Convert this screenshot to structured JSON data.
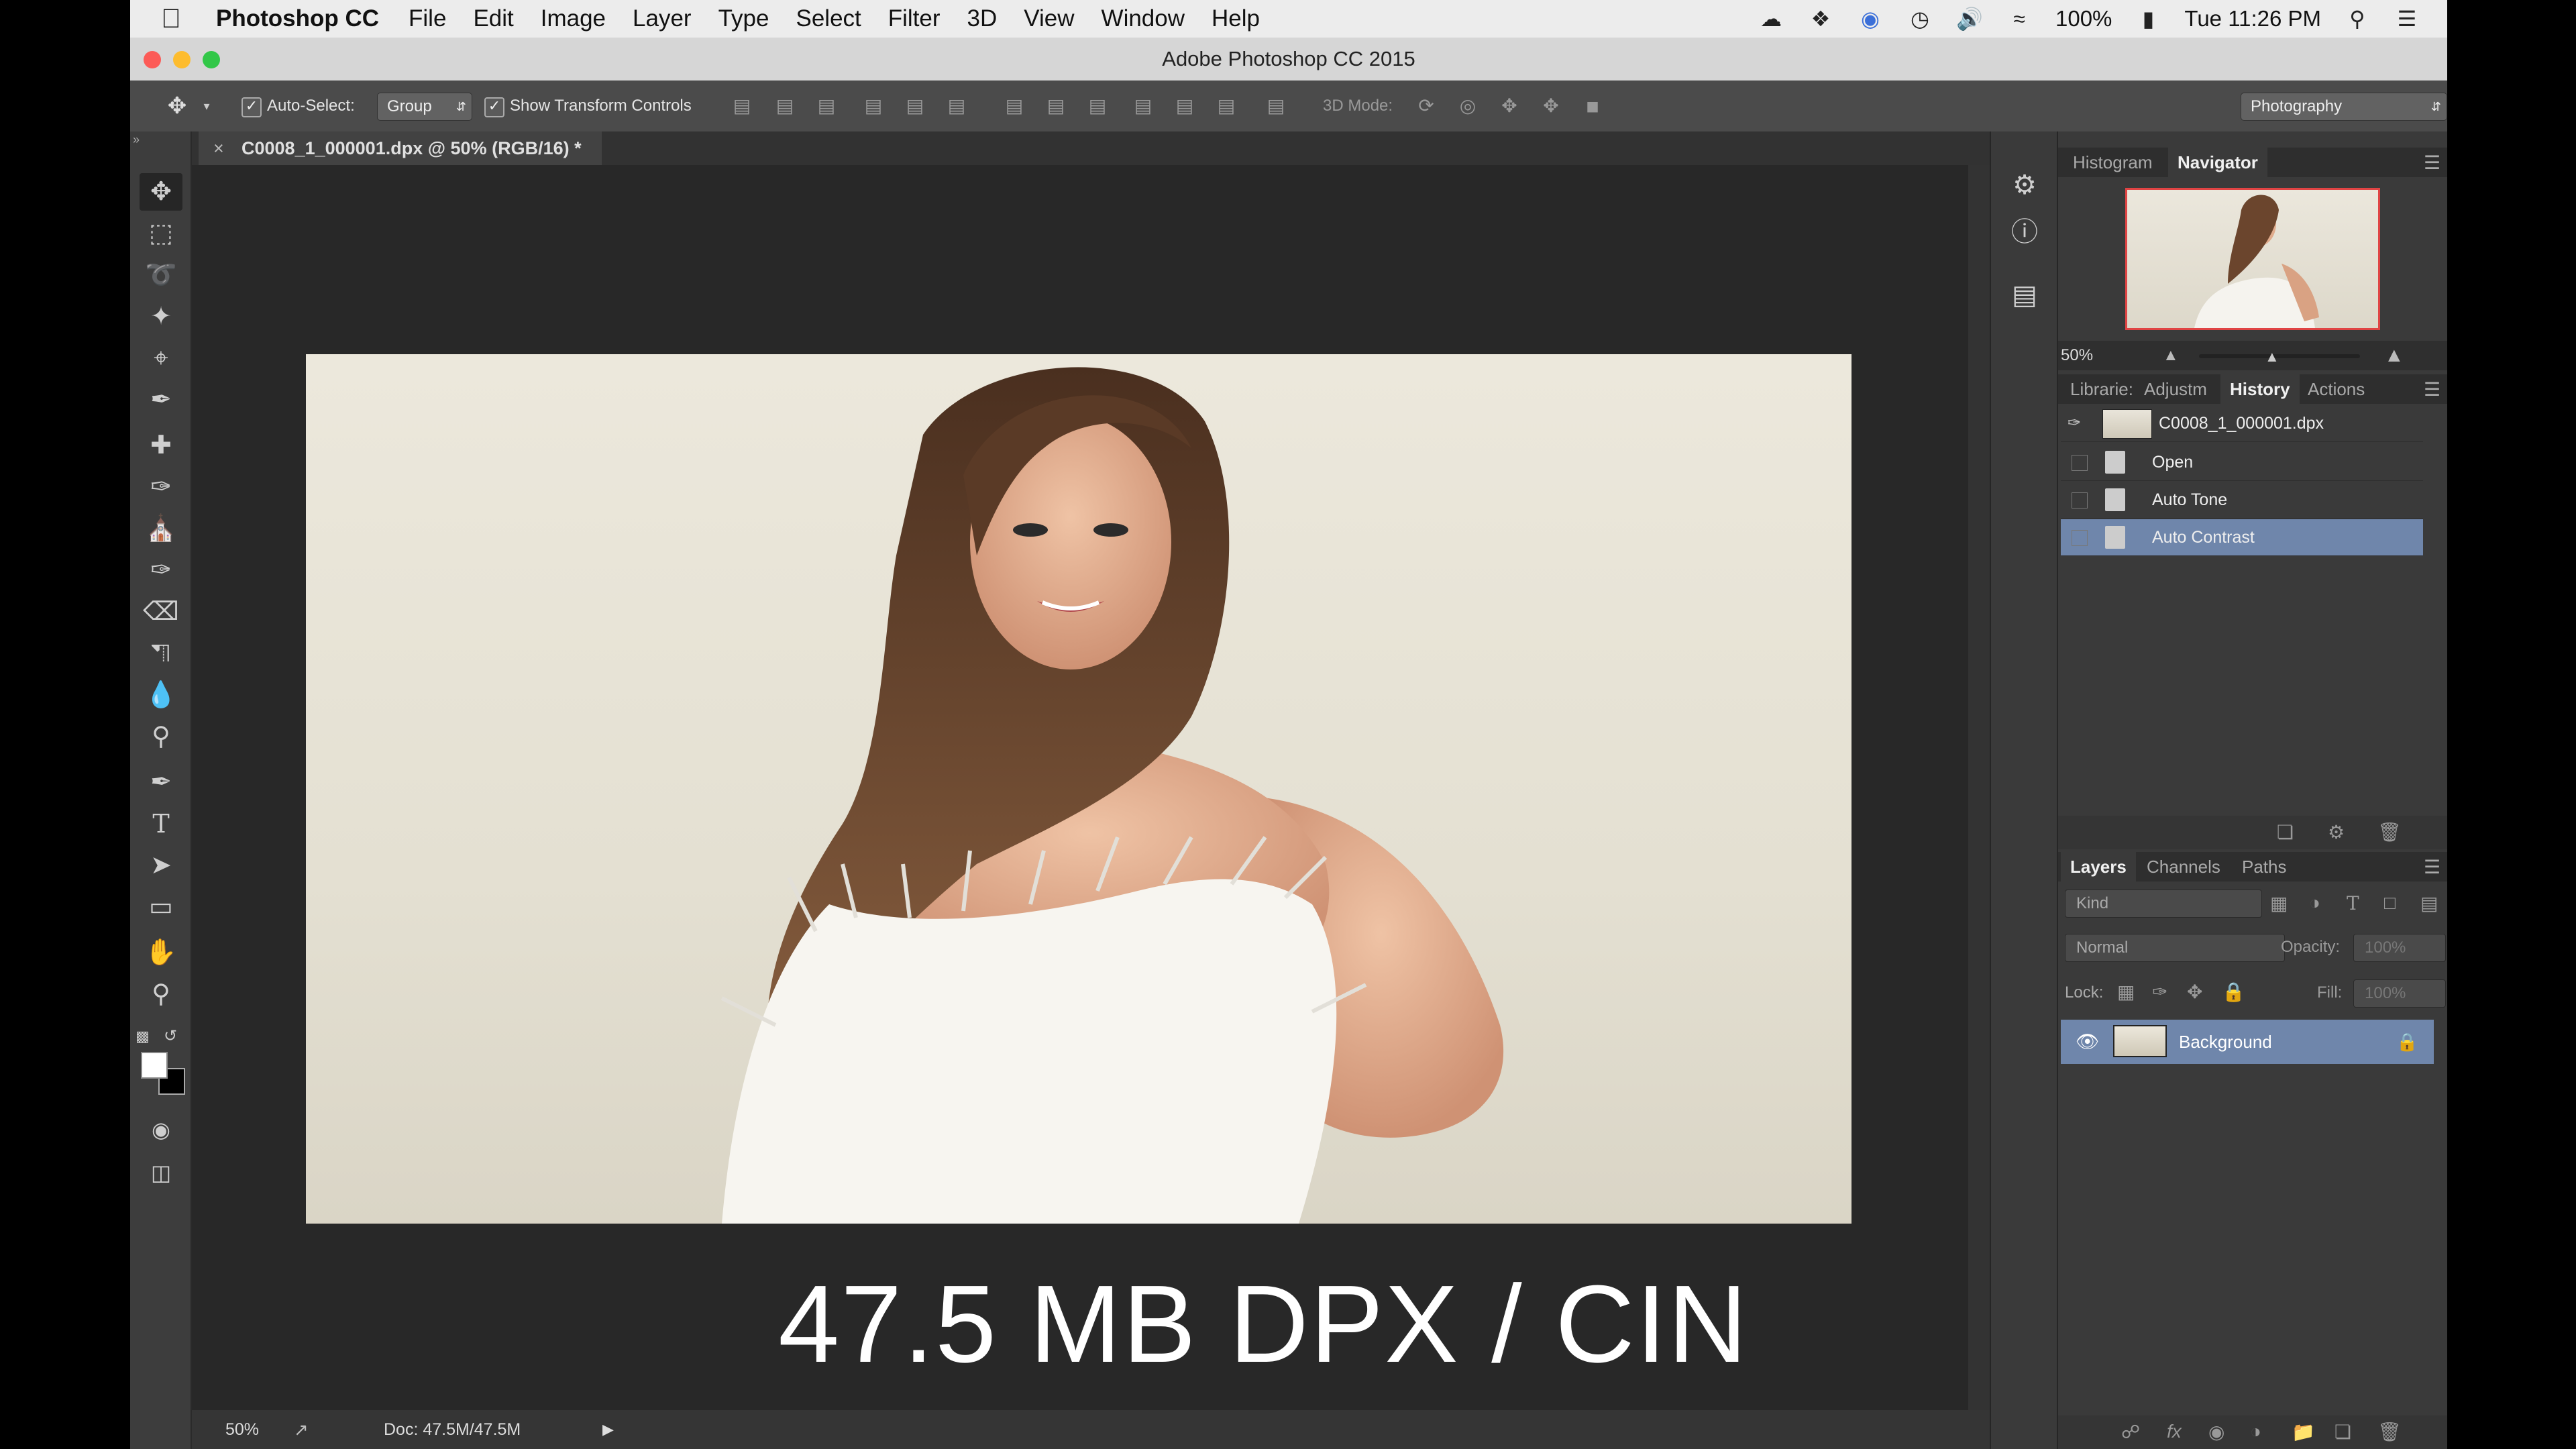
{
  "menubar": {
    "app_name": "Photoshop CC",
    "items": [
      "File",
      "Edit",
      "Image",
      "Layer",
      "Type",
      "Select",
      "Filter",
      "3D",
      "View",
      "Window",
      "Help"
    ],
    "battery": "100%",
    "clock": "Tue 11:26 PM"
  },
  "window": {
    "title": "Adobe Photoshop CC 2015"
  },
  "options_bar": {
    "auto_select_label": "Auto-Select:",
    "auto_select_value": "Group",
    "transform_label": "Show Transform Controls",
    "mode_3d_label": "3D Mode:",
    "workspace": "Photography"
  },
  "document": {
    "tab_title": "C0008_1_000001.dpx @ 50% (RGB/16) *",
    "overlay_caption": "47.5 MB DPX / CIN"
  },
  "status": {
    "zoom": "50%",
    "doc_info": "Doc: 47.5M/47.5M"
  },
  "navigator_panel": {
    "tabs": [
      "Histogram",
      "Navigator"
    ],
    "active_tab": "Navigator",
    "zoom": "50%"
  },
  "history_panel": {
    "tabs": [
      "Librarie:",
      "Adjustm",
      "History",
      "Actions"
    ],
    "active_tab": "History",
    "snapshot": "C0008_1_000001.dpx",
    "steps": [
      "Open",
      "Auto Tone",
      "Auto Contrast"
    ],
    "selected_step": "Auto Contrast"
  },
  "layers_panel": {
    "tabs": [
      "Layers",
      "Channels",
      "Paths"
    ],
    "active_tab": "Layers",
    "filter_kind": "Kind",
    "blend_mode": "Normal",
    "opacity_label": "Opacity:",
    "opacity_value": "100%",
    "lock_label": "Lock:",
    "fill_label": "Fill:",
    "fill_value": "100%",
    "layer_name": "Background"
  },
  "colors": {
    "selection": "#6f86ab",
    "panel_bg": "#3a3a3a",
    "canvas_bg": "#282828"
  }
}
